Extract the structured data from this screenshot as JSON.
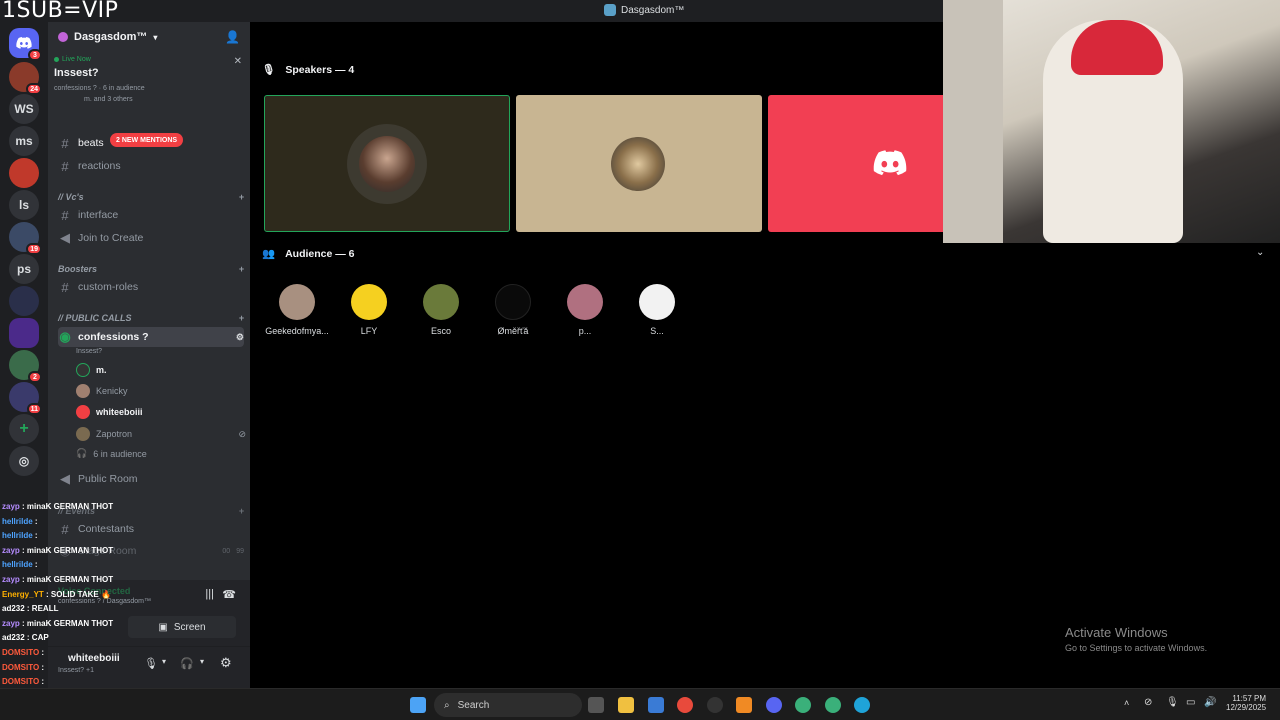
{
  "overlay_text": "1SUB=VIP",
  "window_title": "Dasgasdom™",
  "rail": {
    "items": [
      {
        "label": "",
        "badge": "3"
      },
      {
        "label": "",
        "badge": "24"
      },
      {
        "label": "WS",
        "badge": ""
      },
      {
        "label": "ms",
        "badge": ""
      },
      {
        "label": "",
        "badge": ""
      },
      {
        "label": "ls",
        "badge": ""
      },
      {
        "label": "",
        "badge": "19"
      },
      {
        "label": "ps",
        "badge": ""
      },
      {
        "label": "",
        "badge": ""
      },
      {
        "label": "",
        "badge": ""
      },
      {
        "label": "",
        "badge": "2"
      },
      {
        "label": "",
        "badge": "11"
      }
    ]
  },
  "sidebar": {
    "server_name": "Dasgasdom™",
    "live": {
      "tag": "Live Now",
      "title": "Inssest?",
      "meta": "confessions ? · 6 in audience",
      "people": "m. and 3 others"
    },
    "mentions_pill": "2 NEW MENTIONS",
    "channels": {
      "beats": "beats",
      "reactions": "reactions",
      "vcs_cat": "// Vc's",
      "interface": "interface",
      "join": "Join to Create",
      "boosters_cat": "Boosters",
      "custom_roles": "custom-roles",
      "public_calls_cat": "// PUBLIC CALLS",
      "confessions": "confessions ?",
      "confessions_sub": "Inssest?",
      "public_room": "Public Room",
      "events_cat": "// Events",
      "contestants": "Contestants",
      "stage_room": "Stage Room",
      "stage_counts": [
        "00",
        "99"
      ]
    },
    "voice_users": [
      "m.",
      "Kenicky",
      "whiteeboiii",
      "Zapotron",
      "6 in audience"
    ],
    "voice_panel": {
      "status": "Voice Connected",
      "channel": "confessions ? / Dasgasdom™",
      "screen_label": "Screen"
    },
    "user": {
      "name": "whiteeboiii",
      "status": "Inssest? +1"
    }
  },
  "chat": [
    {
      "user": "zayp",
      "msg": "minaK GERMAN THOT",
      "color": "#b58cff"
    },
    {
      "user": "hellrilde",
      "msg": "",
      "color": "#4ea3ff"
    },
    {
      "user": "hellrilde",
      "msg": "",
      "color": "#4ea3ff"
    },
    {
      "user": "zayp",
      "msg": "minaK GERMAN THOT",
      "color": "#b58cff"
    },
    {
      "user": "hellrilde",
      "msg": "",
      "color": "#4ea3ff"
    },
    {
      "user": "zayp",
      "msg": "minaK GERMAN THOT",
      "color": "#b58cff"
    },
    {
      "user": "Energy_YT",
      "msg": "SOLID TAKE 🔥",
      "color": "#ffb000"
    },
    {
      "user": "ad232",
      "msg": "REALL",
      "color": "#ffffff"
    },
    {
      "user": "zayp",
      "msg": "minaK GERMAN THOT",
      "color": "#b58cff"
    },
    {
      "user": "ad232",
      "msg": "CAP",
      "color": "#ffffff"
    },
    {
      "user": "DOMSITO",
      "msg": "",
      "color": "#ff5a3c"
    },
    {
      "user": "DOMSITO",
      "msg": "",
      "color": "#ff5a3c"
    },
    {
      "user": "DOMSITO",
      "msg": "",
      "color": "#ff5a3c"
    },
    {
      "user": "DOMSITO",
      "msg": "",
      "color": "#ff5a3c"
    }
  ],
  "main": {
    "speakers_label": "Speakers — 4",
    "audience_label": "Audience — 6",
    "audience": [
      "Geekedofmya...",
      "LFY",
      "Esco",
      "Øměřťă",
      "p...",
      "S..."
    ]
  },
  "watermark": {
    "title": "Activate Windows",
    "sub": "Go to Settings to activate Windows."
  },
  "taskbar": {
    "search": "Search",
    "time": "11:57 PM",
    "date": "12/29/2025"
  },
  "colors": {
    "accent": "#5865f2",
    "live": "#23a55a",
    "danger": "#f23f43"
  }
}
